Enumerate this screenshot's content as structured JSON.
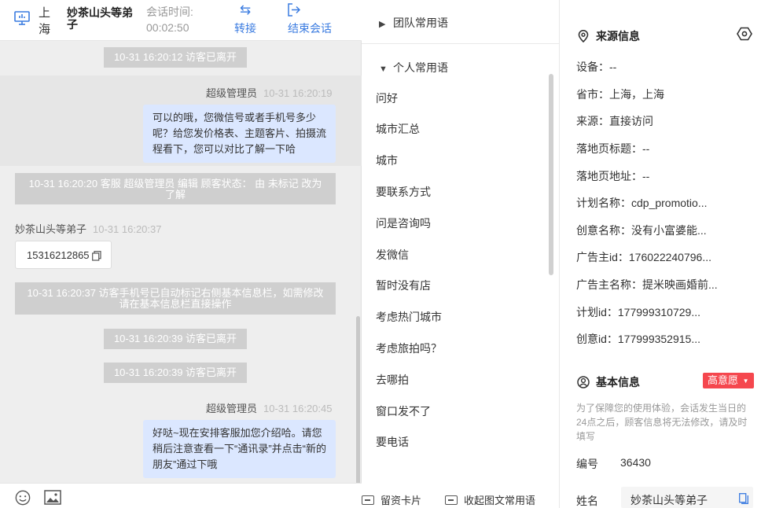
{
  "header": {
    "city": "上海",
    "visitor_name": "妙茶山头等弟子",
    "time_label": "会话时间:",
    "time_value": "00:02:50",
    "transfer_label": "转接",
    "end_label": "结束会话"
  },
  "messages": {
    "sys1": "10-31 16:20:12 访客已离开",
    "agent1_name": "超级管理员",
    "agent1_time": "10-31 16:20:19",
    "agent1_text": "可以的哦，您微信号或者手机号多少呢？给您发价格表、主题客片、拍摄流程看下，您可以对比了解一下哈",
    "sys2": "10-31 16:20:20 客服 超级管理员 编辑 顾客状态： 由 未标记 改为 了解",
    "visitor_name": "妙茶山头等弟子",
    "visitor_time": "10-31 16:20:37",
    "visitor_text": "15316212865",
    "sys3": "10-31 16:20:37 访客手机号已自动标记右侧基本信息栏，如需修改请在基本信息栏直接操作",
    "sys4": "10-31 16:20:39 访客已离开",
    "sys5": "10-31 16:20:39 访客已离开",
    "agent2_name": "超级管理员",
    "agent2_time": "10-31 16:20:45",
    "agent2_text": "好哒~现在安排客服加您介绍哈。请您稍后注意查看一下“通讯录”并点击“新的朋友”通过下哦"
  },
  "quick_replies": {
    "team_group": "团队常用语",
    "personal_group": "个人常用语",
    "items": [
      "问好",
      "城市汇总",
      "城市",
      "要联系方式",
      "问是咨询吗",
      "发微信",
      "暂时没有店",
      "考虑热门城市",
      "考虑旅拍吗？",
      "去哪拍",
      "窗口发不了",
      "要电话"
    ],
    "footer_card": "留资卡片",
    "footer_collapse": "收起图文常用语"
  },
  "source_info": {
    "title": "来源信息",
    "device": "设备：--",
    "province_city": "省市：上海，上海",
    "source": "来源：直接访问",
    "landing_title": "落地页标题：--",
    "landing_url": "落地页地址：--",
    "plan_name": "计划名称：cdp_promotio...",
    "creative_name": "创意名称：没有小富婆能...",
    "advertiser_id": "广告主id：176022240796...",
    "advertiser_name": "广告主名称：提米映画婚前...",
    "plan_id": "计划id：177999310729...",
    "creative_id": "创意id：177999352915..."
  },
  "basic_info": {
    "title": "基本信息",
    "intent_badge": "高意愿",
    "note": "为了保障您的使用体验，会话发生当日的24点之后，顾客信息将无法修改，请及时填写",
    "id_label": "编号",
    "id_value": "36430",
    "name_label": "姓名",
    "name_value": "妙茶山头等弟子"
  },
  "colors": {
    "accent": "#3a7be0",
    "agent_bubble": "#dbe7ff",
    "system_msg": "#cfcfcf",
    "badge": "#f5474e"
  }
}
